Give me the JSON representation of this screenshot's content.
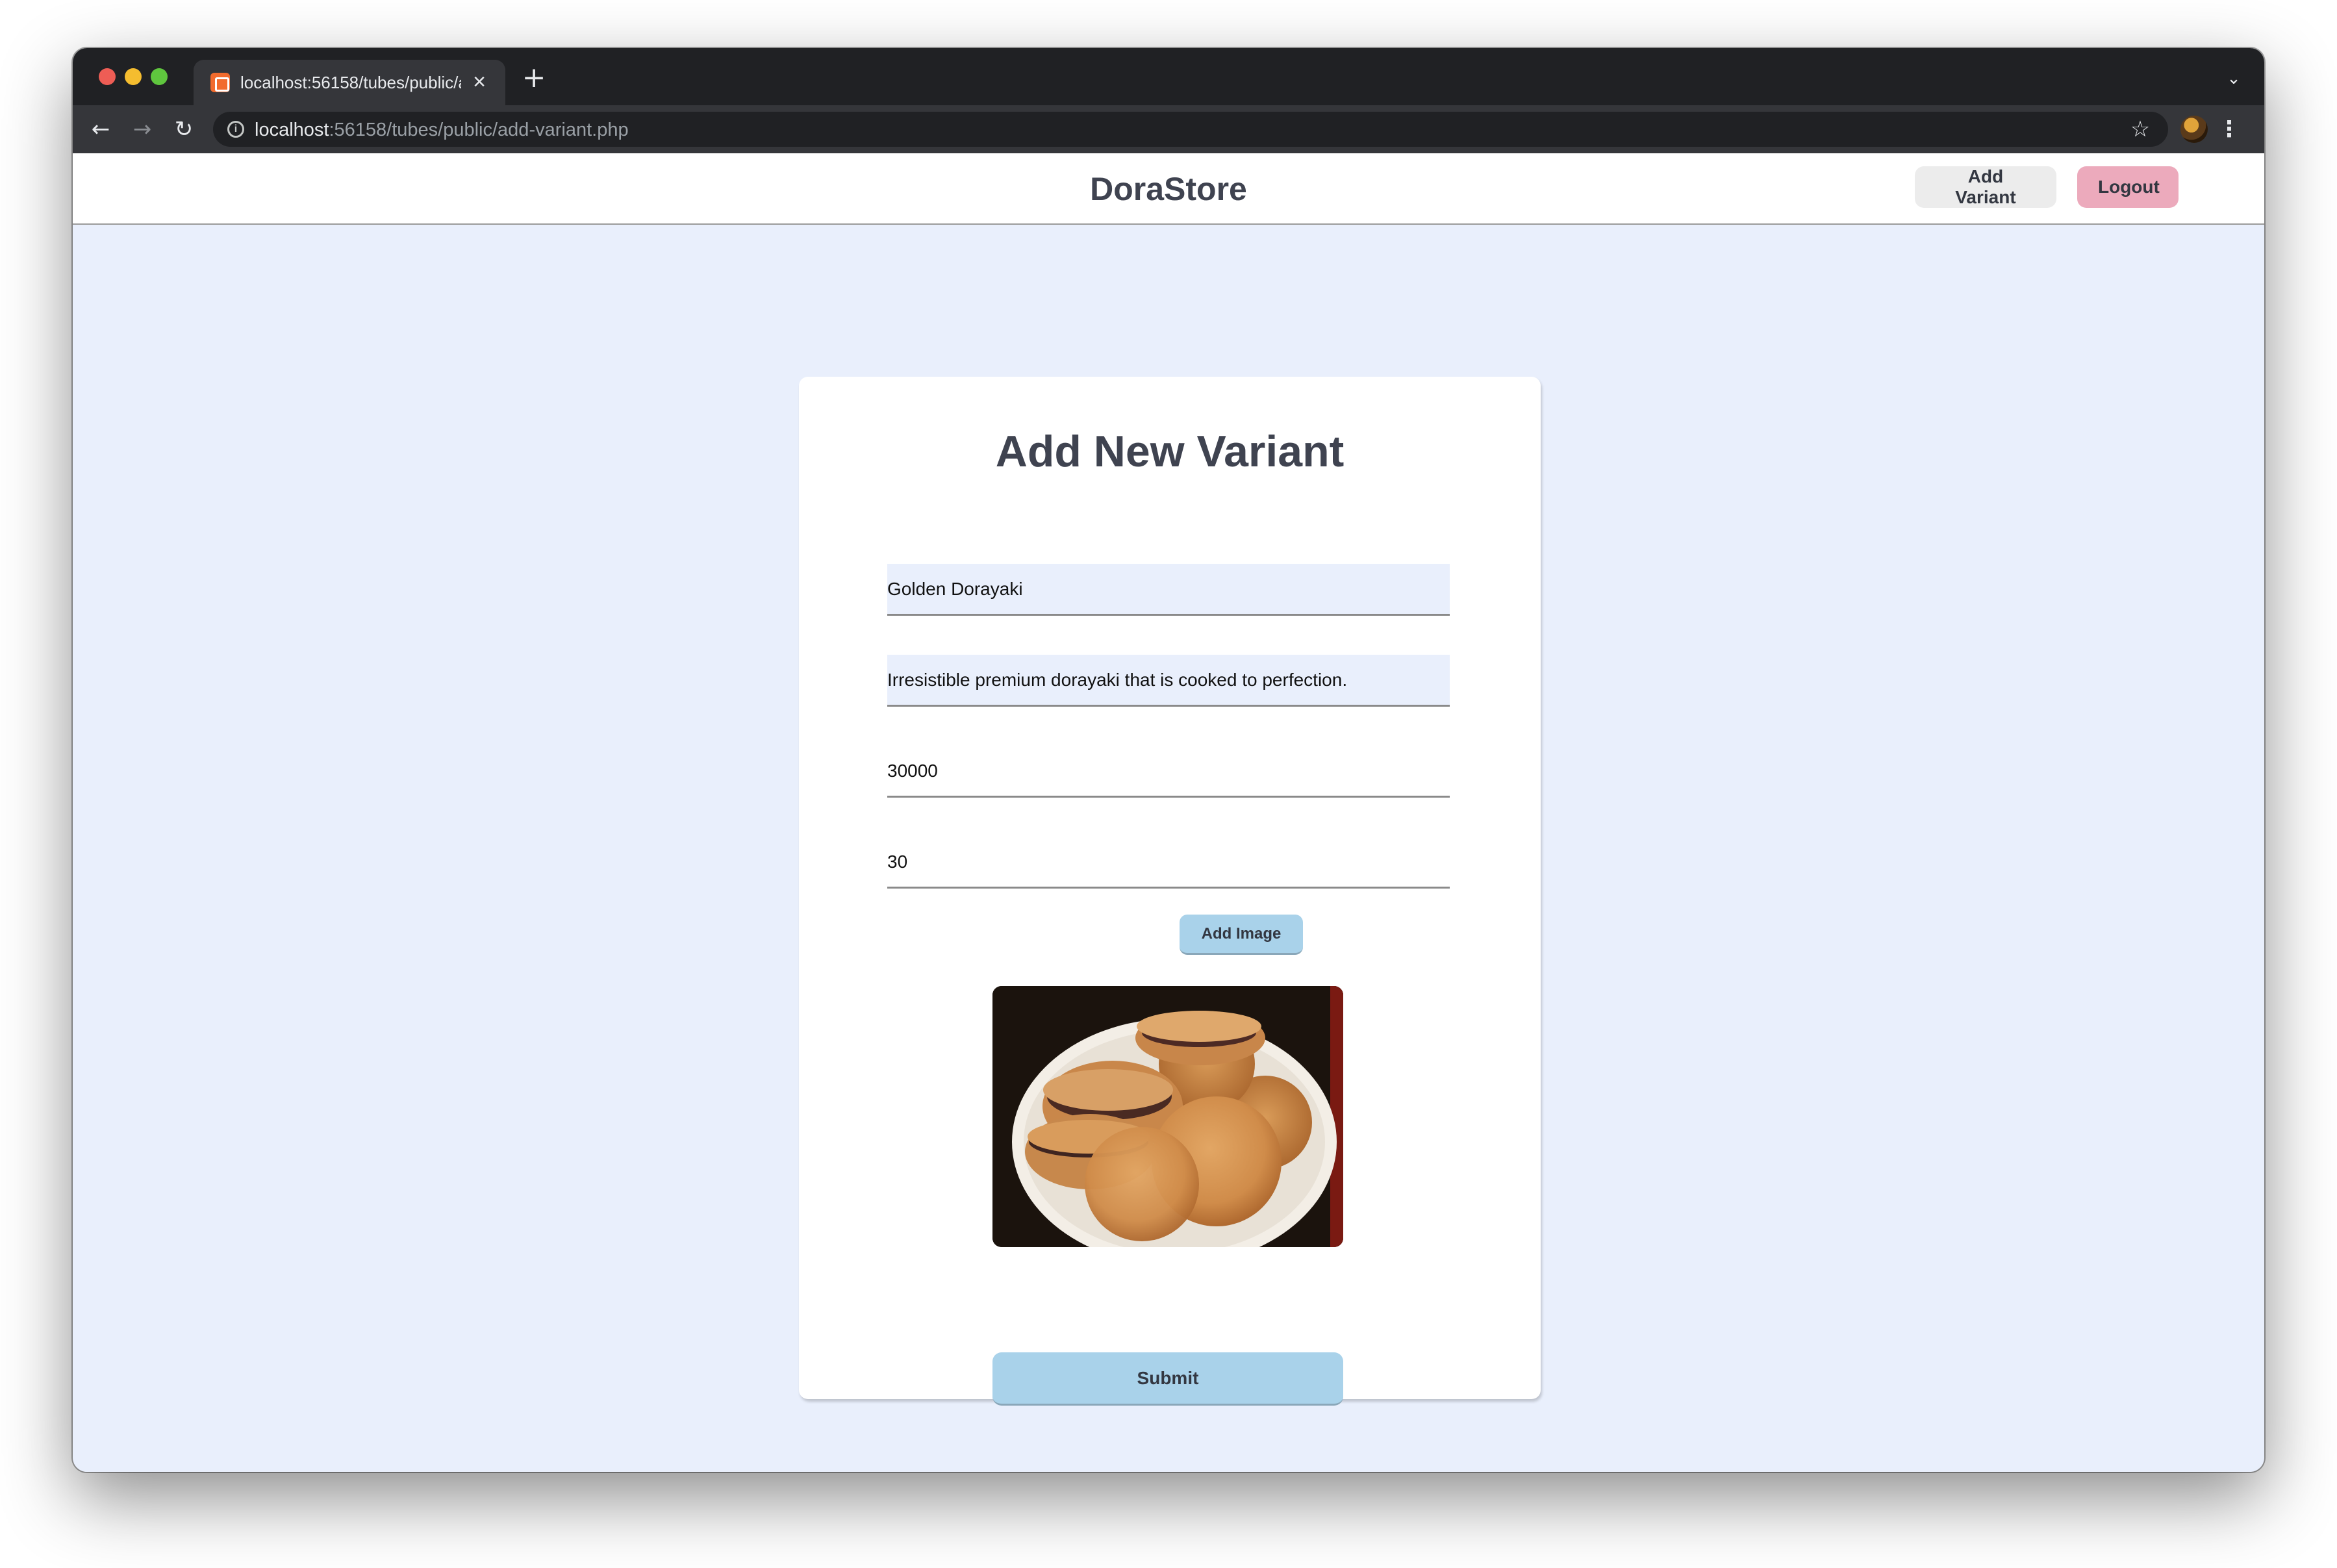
{
  "browser": {
    "tab_title": "localhost:56158/tubes/public/add-variant.php",
    "url_host": "localhost",
    "url_path": ":56158/tubes/public/add-variant.php"
  },
  "header": {
    "brand": "DoraStore",
    "add_variant_label": "Add Variant",
    "logout_label": "Logout"
  },
  "form": {
    "title": "Add New Variant",
    "name_value": "Golden Dorayaki",
    "description_value": "Irresistible premium dorayaki that is cooked to perfection.",
    "price_value": "30000",
    "stock_value": "30",
    "add_image_label": "Add Image",
    "submit_label": "Submit"
  },
  "colors": {
    "page_background": "#e9effc",
    "primary_button": "#a9d2ea",
    "logout_button": "#ecaabc",
    "text_dark": "#3f4350"
  }
}
